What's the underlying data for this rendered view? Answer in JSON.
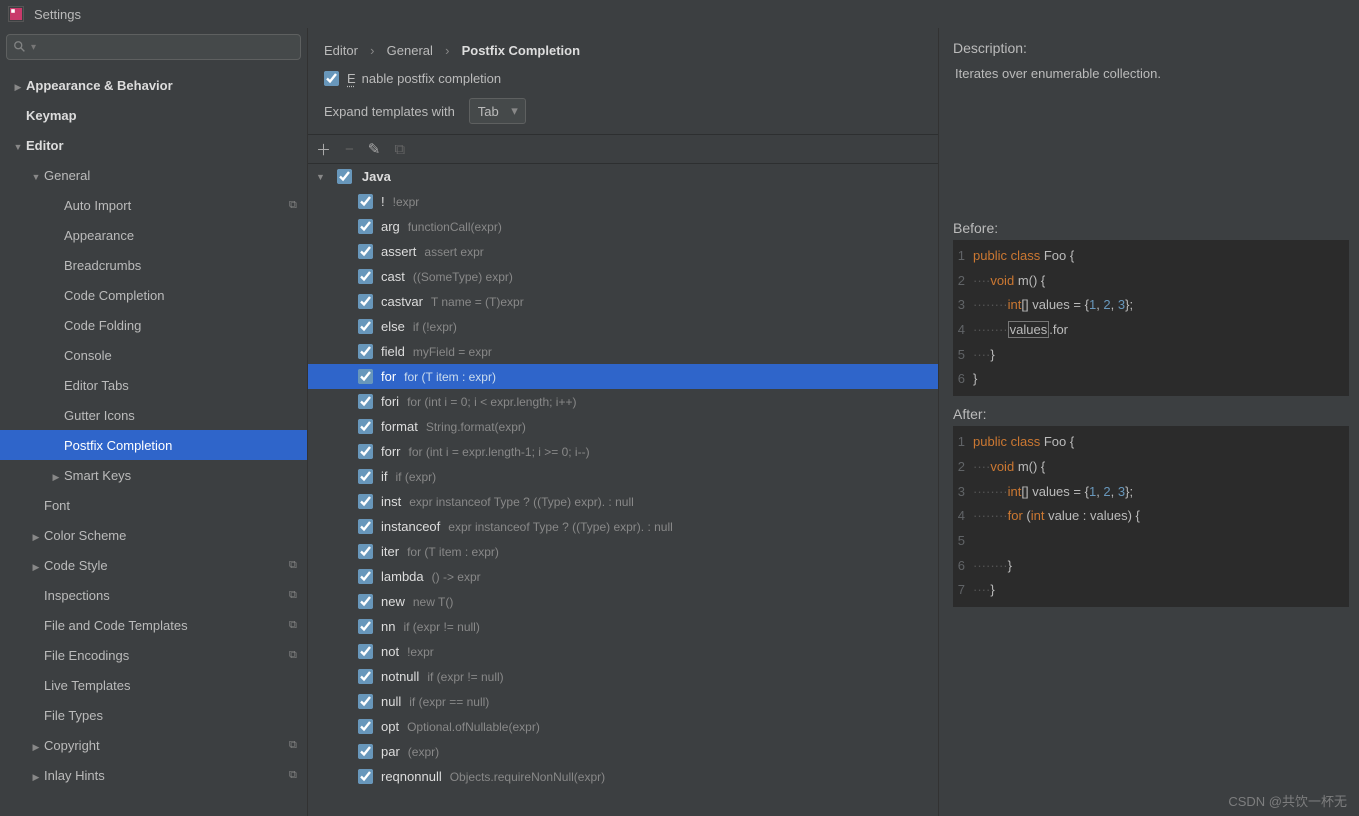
{
  "window": {
    "title": "Settings"
  },
  "sidebar": {
    "nodes": [
      {
        "label": "Appearance & Behavior",
        "arrow": "closed",
        "ind": 0,
        "bold": true
      },
      {
        "label": "Keymap",
        "arrow": "none",
        "ind": 0,
        "bold": true
      },
      {
        "label": "Editor",
        "arrow": "open",
        "ind": 0,
        "bold": true
      },
      {
        "label": "General",
        "arrow": "open",
        "ind": 1
      },
      {
        "label": "Auto Import",
        "arrow": "none",
        "ind": 2,
        "cfg": true
      },
      {
        "label": "Appearance",
        "arrow": "none",
        "ind": 2
      },
      {
        "label": "Breadcrumbs",
        "arrow": "none",
        "ind": 2
      },
      {
        "label": "Code Completion",
        "arrow": "none",
        "ind": 2
      },
      {
        "label": "Code Folding",
        "arrow": "none",
        "ind": 2
      },
      {
        "label": "Console",
        "arrow": "none",
        "ind": 2
      },
      {
        "label": "Editor Tabs",
        "arrow": "none",
        "ind": 2
      },
      {
        "label": "Gutter Icons",
        "arrow": "none",
        "ind": 2
      },
      {
        "label": "Postfix Completion",
        "arrow": "none",
        "ind": 2,
        "sel": true
      },
      {
        "label": "Smart Keys",
        "arrow": "closed",
        "ind": 2
      },
      {
        "label": "Font",
        "arrow": "none",
        "ind": 1
      },
      {
        "label": "Color Scheme",
        "arrow": "closed",
        "ind": 1
      },
      {
        "label": "Code Style",
        "arrow": "closed",
        "ind": 1,
        "cfg": true
      },
      {
        "label": "Inspections",
        "arrow": "none",
        "ind": 1,
        "cfg": true
      },
      {
        "label": "File and Code Templates",
        "arrow": "none",
        "ind": 1,
        "cfg": true
      },
      {
        "label": "File Encodings",
        "arrow": "none",
        "ind": 1,
        "cfg": true
      },
      {
        "label": "Live Templates",
        "arrow": "none",
        "ind": 1
      },
      {
        "label": "File Types",
        "arrow": "none",
        "ind": 1
      },
      {
        "label": "Copyright",
        "arrow": "closed",
        "ind": 1,
        "cfg": true
      },
      {
        "label": "Inlay Hints",
        "arrow": "closed",
        "ind": 1,
        "cfg": true
      }
    ]
  },
  "breadcrumb": {
    "a": "Editor",
    "b": "General",
    "c": "Postfix Completion"
  },
  "options": {
    "enable_label": "Enable postfix completion",
    "enable_checked": true,
    "expand_label": "Expand templates with",
    "expand_value": "Tab"
  },
  "group": {
    "name": "Java"
  },
  "templates": [
    {
      "key": "!",
      "desc": "!expr"
    },
    {
      "key": "arg",
      "desc": "functionCall(expr)"
    },
    {
      "key": "assert",
      "desc": "assert expr"
    },
    {
      "key": "cast",
      "desc": "((SomeType) expr)"
    },
    {
      "key": "castvar",
      "desc": "T name = (T)expr"
    },
    {
      "key": "else",
      "desc": "if (!expr)"
    },
    {
      "key": "field",
      "desc": "myField = expr"
    },
    {
      "key": "for",
      "desc": "for (T item : expr)",
      "sel": true
    },
    {
      "key": "fori",
      "desc": "for (int i = 0; i < expr.length; i++)"
    },
    {
      "key": "format",
      "desc": "String.format(expr)"
    },
    {
      "key": "forr",
      "desc": "for (int i = expr.length-1; i >= 0; i--)"
    },
    {
      "key": "if",
      "desc": "if (expr)"
    },
    {
      "key": "inst",
      "desc": "expr instanceof Type ? ((Type) expr). : null"
    },
    {
      "key": "instanceof",
      "desc": "expr instanceof Type ? ((Type) expr). : null"
    },
    {
      "key": "iter",
      "desc": "for (T item : expr)"
    },
    {
      "key": "lambda",
      "desc": "() -> expr"
    },
    {
      "key": "new",
      "desc": "new T()"
    },
    {
      "key": "nn",
      "desc": "if (expr != null)"
    },
    {
      "key": "not",
      "desc": "!expr"
    },
    {
      "key": "notnull",
      "desc": "if (expr != null)"
    },
    {
      "key": "null",
      "desc": "if (expr == null)"
    },
    {
      "key": "opt",
      "desc": "Optional.ofNullable(expr)"
    },
    {
      "key": "par",
      "desc": "(expr)"
    },
    {
      "key": "reqnonnull",
      "desc": "Objects.requireNonNull(expr)"
    }
  ],
  "detail": {
    "desc_title": "Description:",
    "description": "Iterates over enumerable collection.",
    "before_title": "Before:",
    "after_title": "After:"
  },
  "watermark": "CSDN @共饮一杯无"
}
